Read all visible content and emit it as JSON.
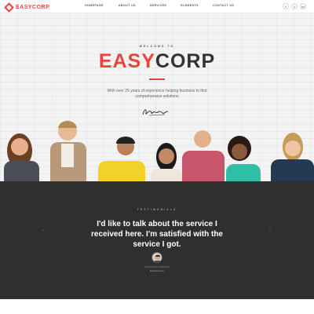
{
  "header": {
    "logo_text": "EASYCORP",
    "nav": [
      "HOMEPAGE",
      "ABOUT US",
      "SERVICES",
      "ELEMENTS",
      "CONTACT US"
    ],
    "social": [
      {
        "icon": "facebook-icon",
        "glyph": "f"
      },
      {
        "icon": "twitter-icon",
        "glyph": "t"
      },
      {
        "icon": "instagram-icon",
        "glyph": "in"
      }
    ]
  },
  "hero": {
    "welcome": "WELCOME TO",
    "brand_part1": "EASY",
    "brand_part2": "CORP",
    "tagline": "With over 25 years of experience helping business to find comprehensive solutions"
  },
  "testimonials": {
    "label": "TESTIMONIALS",
    "quote": "I'd like to talk about the service I received here. I'm satisfied with the service I got.",
    "person_name": "JONATHAN DAVIDSON",
    "person_role": "Businessman",
    "prev_glyph": "‹",
    "next_glyph": "›"
  },
  "colors": {
    "accent": "#e8453c",
    "dark": "#333333",
    "testimonial_bg": "#2f2f2f"
  }
}
